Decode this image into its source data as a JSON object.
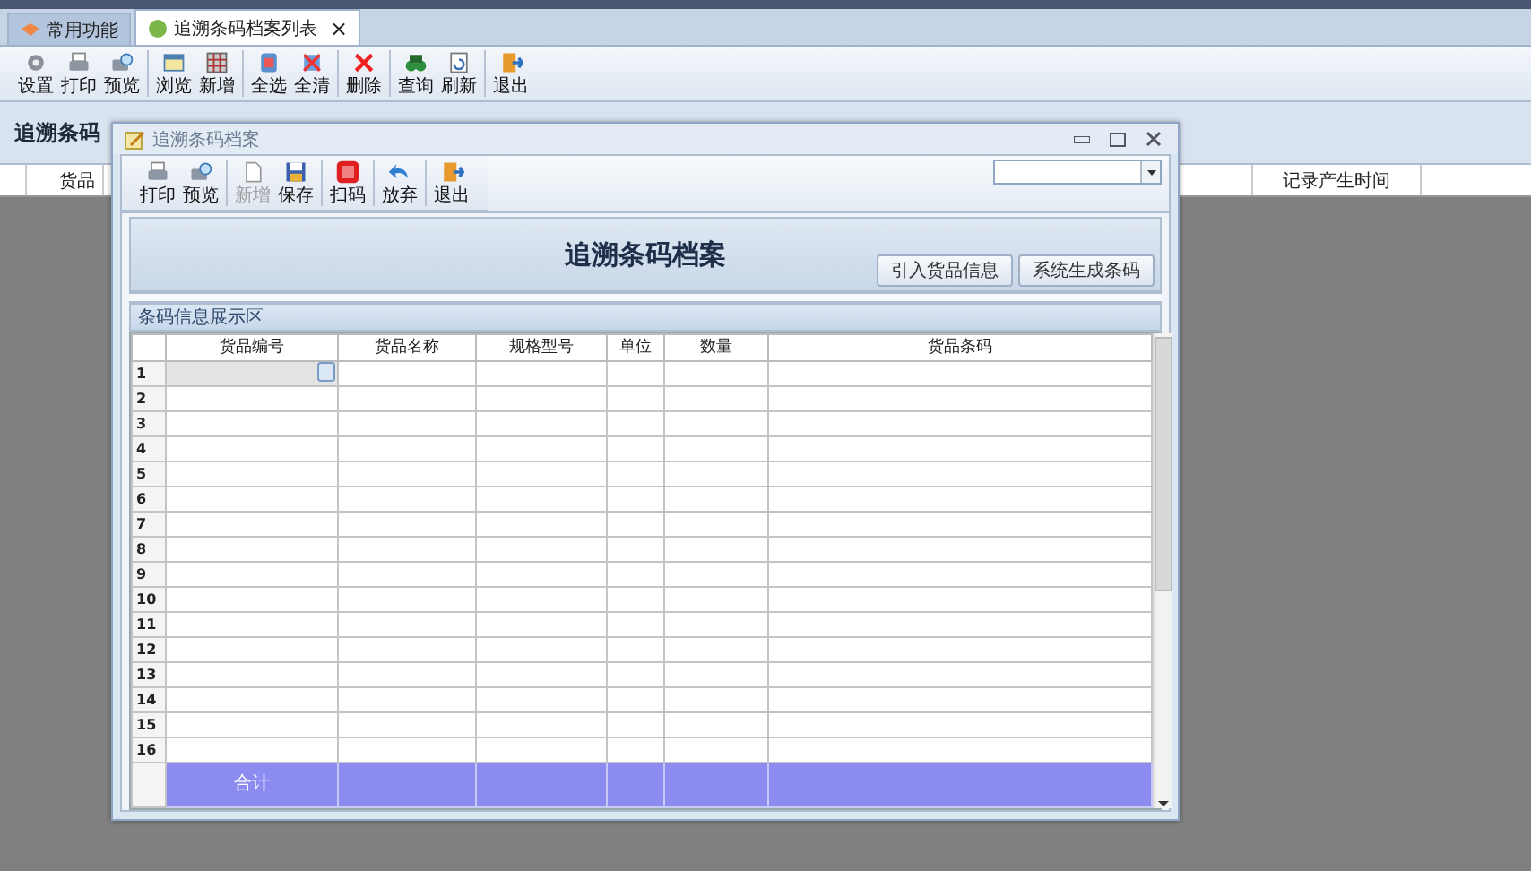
{
  "tabs": [
    {
      "label": "常用功能",
      "selected": false,
      "closable": false
    },
    {
      "label": "追溯条码档案列表",
      "selected": true,
      "closable": true
    }
  ],
  "close_glyph": "×",
  "toolbar": [
    [
      {
        "label": "设置"
      },
      {
        "label": "打印"
      },
      {
        "label": "预览"
      }
    ],
    [
      {
        "label": "浏览"
      },
      {
        "label": "新增"
      }
    ],
    [
      {
        "label": "全选"
      },
      {
        "label": "全清"
      }
    ],
    [
      {
        "label": "删除"
      }
    ],
    [
      {
        "label": "查询"
      },
      {
        "label": "刷新"
      }
    ],
    [
      {
        "label": "退出"
      }
    ]
  ],
  "list_panel": {
    "title": "追溯条码",
    "columns": [
      "货品",
      "记录产生时间"
    ]
  },
  "dialog": {
    "title": "追溯条码档案",
    "toolbar": [
      [
        {
          "label": "打印",
          "disabled": false
        },
        {
          "label": "预览",
          "disabled": false
        }
      ],
      [
        {
          "label": "新增",
          "disabled": true
        },
        {
          "label": "保存",
          "disabled": false
        }
      ],
      [
        {
          "label": "扫码",
          "disabled": false
        }
      ],
      [
        {
          "label": "放弃",
          "disabled": false
        }
      ],
      [
        {
          "label": "退出",
          "disabled": false
        }
      ]
    ],
    "heading": "追溯条码档案",
    "buttons": [
      "引入货品信息",
      "系统生成条码"
    ],
    "section": "条码信息展示区",
    "columns": [
      "货品编号",
      "货品名称",
      "规格型号",
      "单位",
      "数量",
      "货品条码"
    ],
    "rows": [
      {
        "number": "1",
        "selected": true
      },
      {
        "number": "2",
        "selected": false
      },
      {
        "number": "3",
        "selected": false
      },
      {
        "number": "4",
        "selected": false
      },
      {
        "number": "5",
        "selected": false
      },
      {
        "number": "6",
        "selected": false
      },
      {
        "number": "7",
        "selected": false
      },
      {
        "number": "8",
        "selected": false
      },
      {
        "number": "9",
        "selected": false
      },
      {
        "number": "10",
        "selected": false
      },
      {
        "number": "11",
        "selected": false
      },
      {
        "number": "12",
        "selected": false
      },
      {
        "number": "13",
        "selected": false
      },
      {
        "number": "14",
        "selected": false
      },
      {
        "number": "15",
        "selected": false
      },
      {
        "number": "16",
        "selected": false
      }
    ],
    "total_label": "合计"
  }
}
